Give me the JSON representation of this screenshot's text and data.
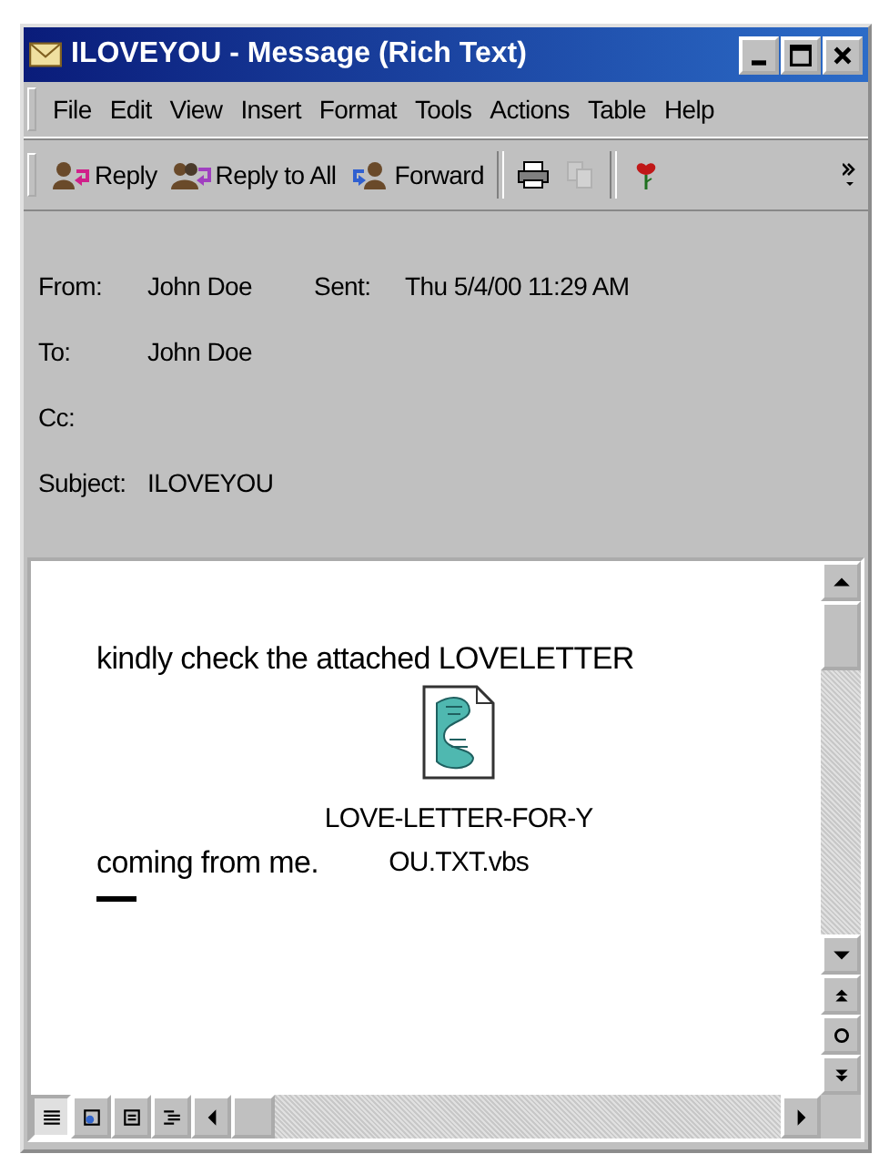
{
  "window": {
    "title": "ILOVEYOU - Message (Rich Text)"
  },
  "menu": [
    "File",
    "Edit",
    "View",
    "Insert",
    "Format",
    "Tools",
    "Actions",
    "Table",
    "Help"
  ],
  "toolbar": [
    {
      "kind": "reply",
      "label": "Reply",
      "disabled": false
    },
    {
      "kind": "reply_all",
      "label": "Reply to All",
      "disabled": false
    },
    {
      "kind": "forward",
      "label": "Forward",
      "disabled": false
    },
    {
      "kind": "print",
      "disabled": false
    },
    {
      "kind": "copy",
      "disabled": true
    },
    {
      "kind": "flag",
      "disabled": false
    }
  ],
  "header": [
    {
      "label": "From:",
      "value": "John Doe",
      "extra_label": "Sent:",
      "extra_value": "Thu 5/4/00 11:29 AM"
    },
    {
      "label": "To:",
      "value": "John Doe"
    },
    {
      "label": "Cc:"
    },
    {
      "label": "Subject:",
      "value": "ILOVEYOU"
    }
  ],
  "body": {
    "line_1": "kindly check the attached LOVELETTER",
    "line_2": "coming from me.",
    "attachment": "LOVE-LETTER-FOR-YOU.TXT.vbs"
  }
}
